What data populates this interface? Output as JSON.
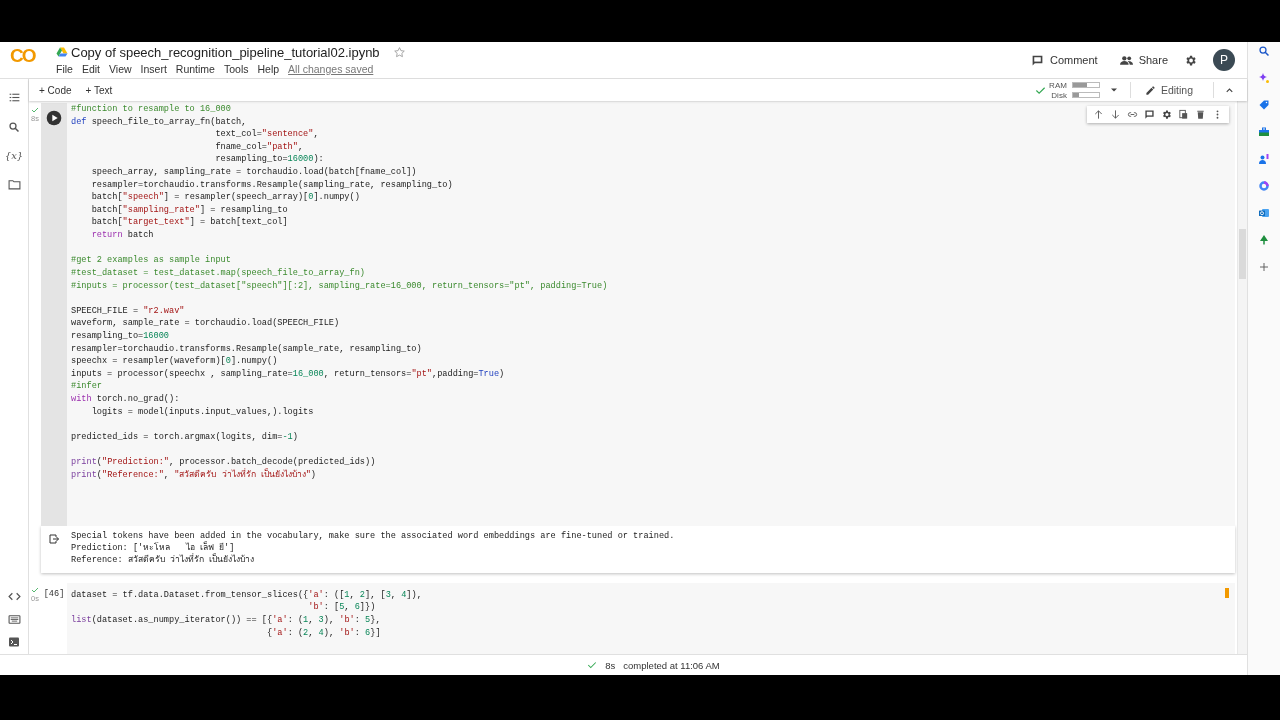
{
  "header": {
    "logo": "CO",
    "title": "Copy of speech_recognition_pipeline_tutorial02.ipynb",
    "starred": false,
    "menu": [
      "File",
      "Edit",
      "View",
      "Insert",
      "Runtime",
      "Tools",
      "Help"
    ],
    "save_status": "All changes saved",
    "actions": [
      {
        "kind": "comment",
        "label": "Comment"
      },
      {
        "kind": "share",
        "label": "Share"
      }
    ],
    "avatar": "P"
  },
  "toolbar": {
    "add_buttons": [
      "+ Code",
      "+ Text"
    ],
    "connected": true,
    "resources": [
      {
        "label": "RAM",
        "level": 0.55
      },
      {
        "label": "Disk",
        "level": 0.25
      }
    ],
    "mode": "Editing"
  },
  "sidebar": {
    "variables_text": "{x}"
  },
  "cells": [
    {
      "focused": true,
      "exec_time": "8s",
      "blocks": [
        [
          [
            {
              "kind": "comment",
              "text": "#function to resample to 16_000"
            }
          ],
          [
            {
              "kind": "keyword",
              "text": "def"
            },
            {
              "kind": "plain",
              "text": " speech_file_to_array_fn(batch,"
            }
          ],
          [
            {
              "kind": "plain",
              "text": "                            text_col="
            },
            {
              "kind": "string",
              "text": "\"sentence\""
            },
            {
              "kind": "plain",
              "text": ","
            }
          ],
          [
            {
              "kind": "plain",
              "text": "                            fname_col="
            },
            {
              "kind": "string",
              "text": "\"path\""
            },
            {
              "kind": "plain",
              "text": ","
            }
          ],
          [
            {
              "kind": "plain",
              "text": "                            resampling_to="
            },
            {
              "kind": "number",
              "text": "16000"
            },
            {
              "kind": "plain",
              "text": "):"
            }
          ],
          [
            {
              "kind": "plain",
              "text": "    speech_array, sampling_rate = torchaudio.load(batch[fname_col])"
            }
          ],
          [
            {
              "kind": "plain",
              "text": "    resampler=torchaudio.transforms.Resample(sampling_rate, resampling_to)"
            }
          ],
          [
            {
              "kind": "plain",
              "text": "    batch["
            },
            {
              "kind": "string",
              "text": "\"speech\""
            },
            {
              "kind": "plain",
              "text": "] = resampler(speech_array)["
            },
            {
              "kind": "number",
              "text": "0"
            },
            {
              "kind": "plain",
              "text": "].numpy()"
            }
          ],
          [
            {
              "kind": "plain",
              "text": "    batch["
            },
            {
              "kind": "string",
              "text": "\"sampling_rate\""
            },
            {
              "kind": "plain",
              "text": "] = resampling_to"
            }
          ],
          [
            {
              "kind": "plain",
              "text": "    batch["
            },
            {
              "kind": "string",
              "text": "\"target_text\""
            },
            {
              "kind": "plain",
              "text": "] = batch[text_col]"
            }
          ],
          [
            {
              "kind": "control",
              "text": "    return"
            },
            {
              "kind": "plain",
              "text": " batch"
            }
          ]
        ],
        [
          [
            {
              "kind": "comment",
              "text": "#get 2 examples as sample input"
            }
          ],
          [
            {
              "kind": "comment",
              "text": "#test_dataset = test_dataset.map(speech_file_to_array_fn)"
            }
          ],
          [
            {
              "kind": "comment",
              "text": "#inputs = processor(test_dataset[\"speech\"][:2], sampling_rate=16_000, return_tensors=\"pt\", padding=True)"
            }
          ]
        ],
        [
          [
            {
              "kind": "plain",
              "text": "SPEECH_FILE = "
            },
            {
              "kind": "string",
              "text": "\"r2.wav\""
            }
          ],
          [
            {
              "kind": "plain",
              "text": "waveform, sample_rate = torchaudio.load(SPEECH_FILE)"
            }
          ],
          [
            {
              "kind": "plain",
              "text": "resampling_to="
            },
            {
              "kind": "number",
              "text": "16000"
            }
          ],
          [
            {
              "kind": "plain",
              "text": "resampler=torchaudio.transforms.Resample(sample_rate, resampling_to)"
            }
          ],
          [
            {
              "kind": "plain",
              "text": "speechx = resampler(waveform)["
            },
            {
              "kind": "number",
              "text": "0"
            },
            {
              "kind": "plain",
              "text": "].numpy()"
            }
          ],
          [
            {
              "kind": "plain",
              "text": "inputs = processor(speechx , sampling_rate="
            },
            {
              "kind": "number",
              "text": "16_000"
            },
            {
              "kind": "plain",
              "text": ", return_tensors="
            },
            {
              "kind": "string",
              "text": "\"pt\""
            },
            {
              "kind": "plain",
              "text": ",padding="
            },
            {
              "kind": "keyword",
              "text": "True"
            },
            {
              "kind": "plain",
              "text": ")"
            }
          ],
          [
            {
              "kind": "comment",
              "text": "#infer"
            }
          ],
          [
            {
              "kind": "control",
              "text": "with"
            },
            {
              "kind": "plain",
              "text": " torch.no_grad():"
            }
          ],
          [
            {
              "kind": "plain",
              "text": "    logits = model(inputs.input_values,).logits"
            }
          ]
        ],
        [
          [
            {
              "kind": "plain",
              "text": "predicted_ids = torch.argmax(logits, dim="
            },
            {
              "kind": "number",
              "text": "-1"
            },
            {
              "kind": "plain",
              "text": ")"
            }
          ]
        ],
        [
          [
            {
              "kind": "builtin",
              "text": "print"
            },
            {
              "kind": "plain",
              "text": "("
            },
            {
              "kind": "string",
              "text": "\"Prediction:\""
            },
            {
              "kind": "plain",
              "text": ", processor.batch_decode(predicted_ids))"
            }
          ],
          [
            {
              "kind": "builtin",
              "text": "print"
            },
            {
              "kind": "plain",
              "text": "("
            },
            {
              "kind": "string",
              "text": "\"Reference:\""
            },
            {
              "kind": "plain",
              "text": ", "
            },
            {
              "kind": "string",
              "text": "\"สวัสดีครับ ว่าไงที่รัก เป็นยังไงบ้าง\""
            },
            {
              "kind": "plain",
              "text": ")"
            }
          ]
        ]
      ],
      "output": [
        "Special tokens have been added in the vocabulary, make sure the associated word embeddings are fine-tuned or trained.",
        "Prediction: ['หะโหล   ไอ เล็ฟ ยี']",
        "Reference: สวัสดีครับ ว่าไงที่รัก เป็นยังไงบ้าง"
      ]
    },
    {
      "focused": false,
      "exec_count": "[46]",
      "exec_time": "0s",
      "blocks": [
        [
          [
            {
              "kind": "plain",
              "text": "dataset = tf.data.Dataset.from_tensor_slices({"
            },
            {
              "kind": "string",
              "text": "'a'"
            },
            {
              "kind": "plain",
              "text": ": (["
            },
            {
              "kind": "number",
              "text": "1"
            },
            {
              "kind": "plain",
              "text": ", "
            },
            {
              "kind": "number",
              "text": "2"
            },
            {
              "kind": "plain",
              "text": "], ["
            },
            {
              "kind": "number",
              "text": "3"
            },
            {
              "kind": "plain",
              "text": ", "
            },
            {
              "kind": "number",
              "text": "4"
            },
            {
              "kind": "plain",
              "text": "]),"
            }
          ],
          [
            {
              "kind": "string",
              "text": "                                              'b'"
            },
            {
              "kind": "plain",
              "text": ": ["
            },
            {
              "kind": "number",
              "text": "5"
            },
            {
              "kind": "plain",
              "text": ", "
            },
            {
              "kind": "number",
              "text": "6"
            },
            {
              "kind": "plain",
              "text": "]})"
            }
          ],
          [
            {
              "kind": "builtin",
              "text": "list"
            },
            {
              "kind": "plain",
              "text": "(dataset.as_numpy_iterator()) == [{"
            },
            {
              "kind": "string",
              "text": "'a'"
            },
            {
              "kind": "plain",
              "text": ": ("
            },
            {
              "kind": "number",
              "text": "1"
            },
            {
              "kind": "plain",
              "text": ", "
            },
            {
              "kind": "number",
              "text": "3"
            },
            {
              "kind": "plain",
              "text": "), "
            },
            {
              "kind": "string",
              "text": "'b'"
            },
            {
              "kind": "plain",
              "text": ": "
            },
            {
              "kind": "number",
              "text": "5"
            },
            {
              "kind": "plain",
              "text": "},"
            }
          ],
          [
            {
              "kind": "plain",
              "text": "                                      {"
            },
            {
              "kind": "string",
              "text": "'a'"
            },
            {
              "kind": "plain",
              "text": ": ("
            },
            {
              "kind": "number",
              "text": "2"
            },
            {
              "kind": "plain",
              "text": ", "
            },
            {
              "kind": "number",
              "text": "4"
            },
            {
              "kind": "plain",
              "text": "), "
            },
            {
              "kind": "string",
              "text": "'b'"
            },
            {
              "kind": "plain",
              "text": ": "
            },
            {
              "kind": "number",
              "text": "6"
            },
            {
              "kind": "plain",
              "text": "}]"
            }
          ]
        ]
      ]
    }
  ],
  "status_bar": {
    "ok": true,
    "duration": "8s",
    "message": "completed at 11:06 AM"
  }
}
